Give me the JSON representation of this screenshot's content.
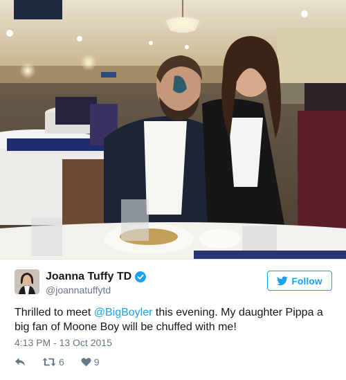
{
  "tweet": {
    "author_name": "Joanna Tuffy TD",
    "author_handle": "@joannatuffytd",
    "follow_label": "Follow",
    "text_before": "Thrilled to meet ",
    "mention": "@BigBoyler",
    "text_after": " this evening. My daughter Pippa a big fan of Moone Boy will be chuffed with me!",
    "timestamp": "4:13 PM - 13 Oct 2015",
    "retweets": "6",
    "likes": "9"
  },
  "icons": {
    "verified": "verified-badge-icon",
    "follow": "twitter-bird-icon",
    "reply": "reply-icon",
    "retweet": "retweet-icon",
    "like": "heart-icon"
  },
  "colors": {
    "accent": "#1da1f2",
    "secondary_text": "#657786",
    "primary_text": "#14171a"
  }
}
